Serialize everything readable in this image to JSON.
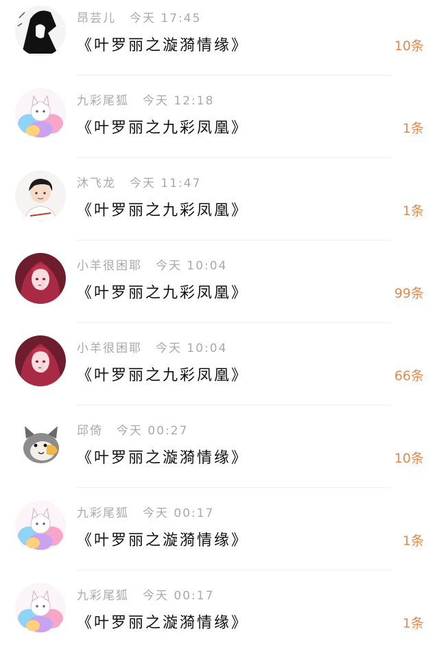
{
  "messages": [
    {
      "name": "昂芸儿",
      "time": "今天 17:45",
      "title": "《叶罗丽之漩漪情缘》",
      "count": "10条",
      "avatar": "avatar-sketch"
    },
    {
      "name": "九彩尾狐",
      "time": "今天 12:18",
      "title": "《叶罗丽之九彩凤凰》",
      "count": "1条",
      "avatar": "avatar-fox"
    },
    {
      "name": "沐飞龙",
      "time": "今天 11:47",
      "title": "《叶罗丽之九彩凤凰》",
      "count": "1条",
      "avatar": "avatar-boy"
    },
    {
      "name": "小羊很困耶",
      "time": "今天 10:04",
      "title": "《叶罗丽之九彩凤凰》",
      "count": "99条",
      "avatar": "avatar-girl"
    },
    {
      "name": "小羊很困耶",
      "time": "今天 10:04",
      "title": "《叶罗丽之九彩凤凰》",
      "count": "66条",
      "avatar": "avatar-girl"
    },
    {
      "name": "邱倚",
      "time": "今天 00:27",
      "title": "《叶罗丽之漩漪情缘》",
      "count": "10条",
      "avatar": "avatar-cat"
    },
    {
      "name": "九彩尾狐",
      "time": "今天 00:17",
      "title": "《叶罗丽之漩漪情缘》",
      "count": "1条",
      "avatar": "avatar-fox"
    },
    {
      "name": "九彩尾狐",
      "time": "今天 00:17",
      "title": "《叶罗丽之漩漪情缘》",
      "count": "1条",
      "avatar": "avatar-fox"
    }
  ],
  "colors": {
    "count": "#e08a4f",
    "meta": "#a9a9a9",
    "title": "#111111"
  }
}
